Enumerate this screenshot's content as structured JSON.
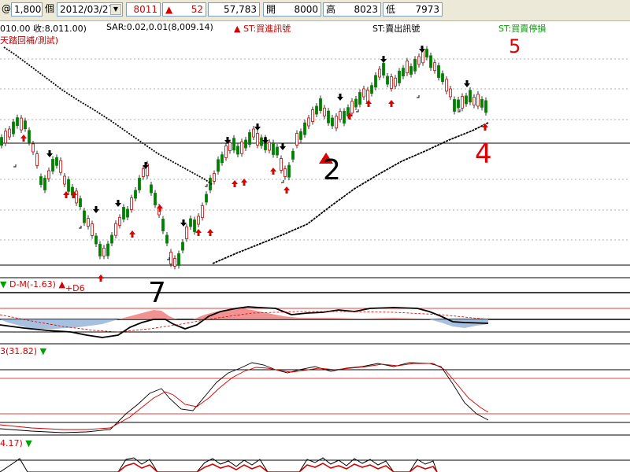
{
  "toolbar": {
    "at_symbol": "@",
    "qty_value": "1,800",
    "unit_label": "個",
    "date_value": "2012/03/27",
    "last_price": "8011",
    "change": "52",
    "volume": "57,783",
    "open_label": "開",
    "open_value": "8000",
    "high_label": "高",
    "high_value": "8023",
    "low_label": "低",
    "low_value": "7973"
  },
  "main_panel": {
    "info_text": "010.00 收:8,011.00)",
    "sar_text": "SAR:0.02,0.01(8,009.14)",
    "st_buy": "ST:買進訊號",
    "st_sell": "ST:賣出訊號",
    "st_stop": "ST:買賣停損",
    "subtitle": "天踏回補/測試)"
  },
  "dm_panel": {
    "label": "D-M(-1.63)",
    "d6_label": "+D6"
  },
  "kd_panel": {
    "label": "3(31.82)"
  },
  "bottom_panel": {
    "label": "4.17)"
  },
  "annotations": {
    "n2": "2",
    "n4": "4",
    "n5": "5",
    "n7": "7"
  },
  "colors": {
    "up": "#d40000",
    "down": "#008000",
    "panel_border": "#000000",
    "dm_pos": "#f08080",
    "dm_neg": "#9db9dd"
  }
}
